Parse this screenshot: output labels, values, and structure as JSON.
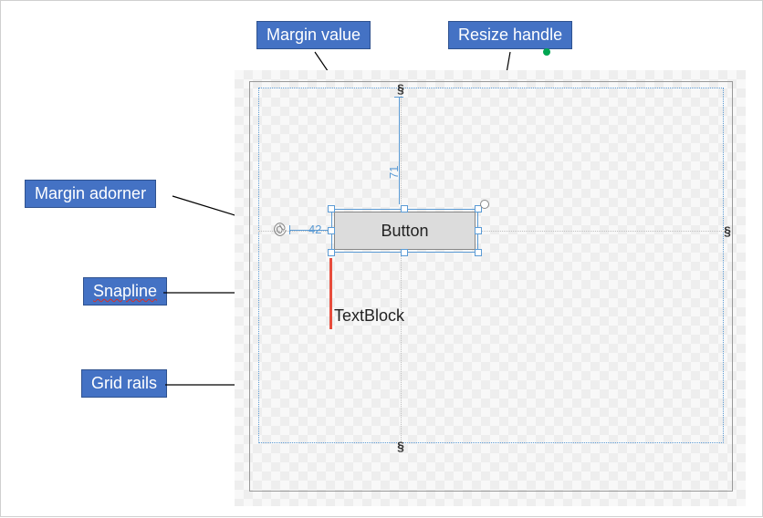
{
  "labels": {
    "margin_adorner": "Margin adorner",
    "margin_value": "Margin value",
    "resize_handle": "Resize handle",
    "snapline": "Snapline",
    "grid_rails": "Grid rails"
  },
  "controls": {
    "button_text": "Button",
    "textblock_text": "TextBlock"
  },
  "margins": {
    "left": "42",
    "top": "71"
  },
  "grid": {
    "top_gripper": "§",
    "bottom_gripper": "§",
    "right_gripper": "§"
  },
  "icons": {
    "adorner": "@"
  }
}
